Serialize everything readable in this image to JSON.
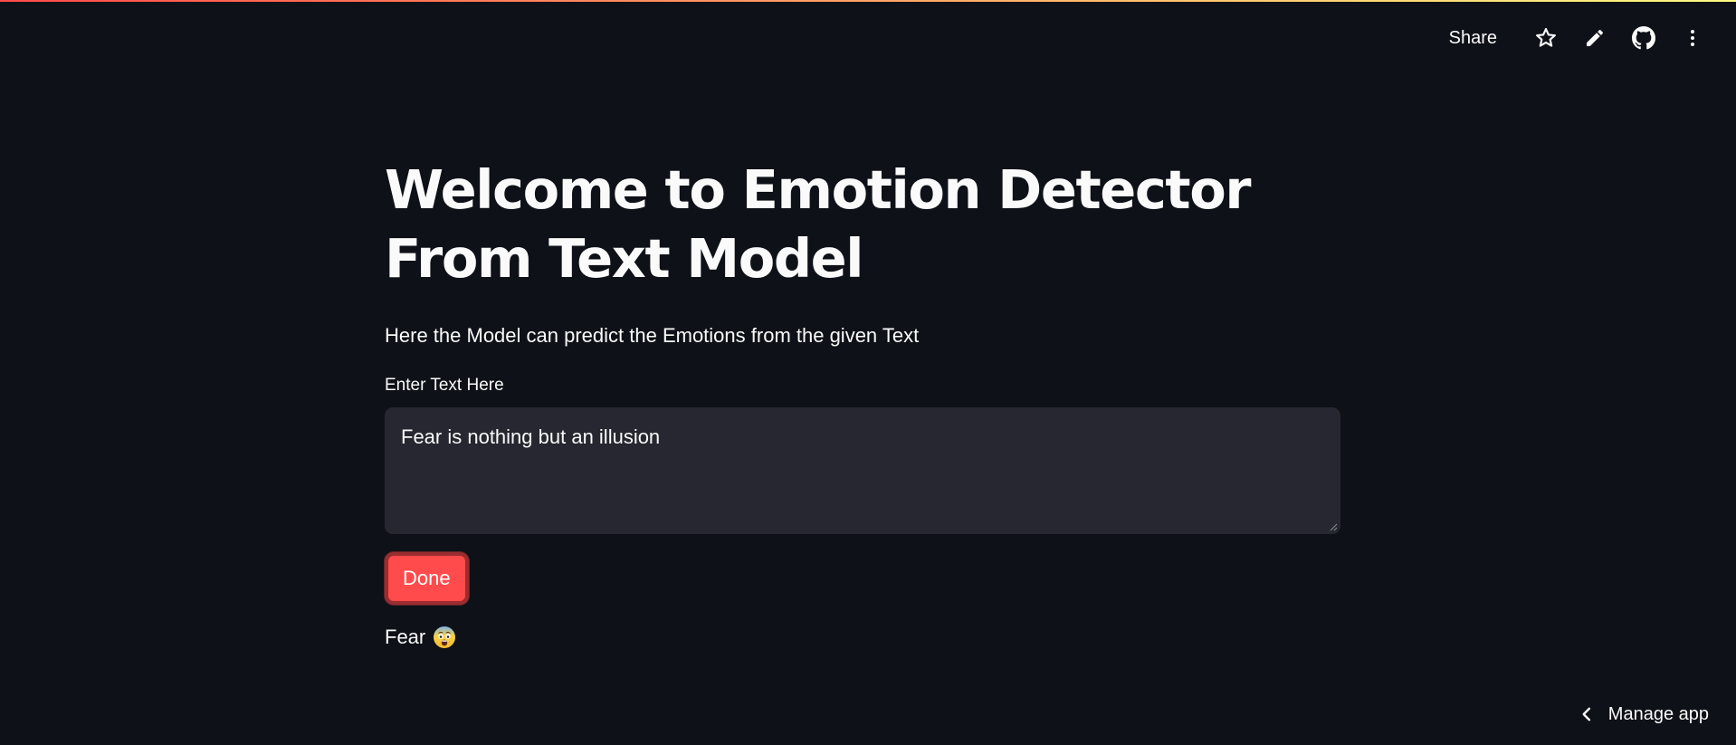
{
  "header": {
    "share_label": "Share",
    "icons": [
      "star-icon",
      "edit-pencil-icon",
      "github-icon",
      "more-vertical-icon"
    ]
  },
  "main": {
    "title": "Welcome to Emotion Detector From Text Model",
    "subtitle": "Here the Model can predict the Emotions from the given Text",
    "input_label": "Enter Text Here",
    "input_value": "Fear is nothing but an illusion",
    "button_label": "Done",
    "result_text": "Fear",
    "result_emoji": "fearful-face-emoji"
  },
  "footer": {
    "manage_app_label": "Manage app"
  },
  "colors": {
    "background": "#0e1117",
    "input_background": "#262730",
    "accent": "#ff4b4b",
    "text": "#fafafa"
  }
}
